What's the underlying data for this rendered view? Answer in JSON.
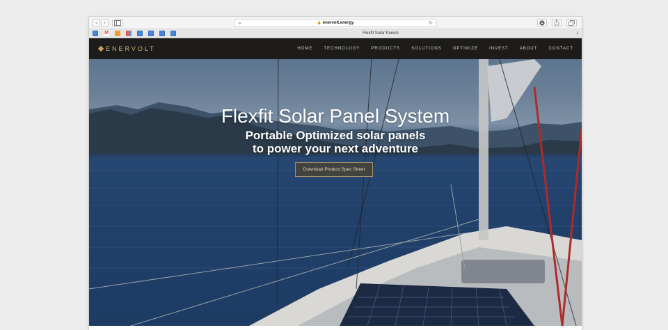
{
  "browser": {
    "url": "enervolt.energy",
    "tab_title": "Flexfit Solar Panels",
    "nav": {
      "back_icon": "‹",
      "forward_icon": "›"
    },
    "tab_plus": "+"
  },
  "site": {
    "logo": "ENERVOLT",
    "menu": [
      "HOME",
      "TECHNOLOGY",
      "PRODUCTS",
      "SOLUTIONS",
      "OPTIMIZE",
      "INVEST",
      "ABOUT",
      "CONTACT"
    ]
  },
  "hero": {
    "title": "Flexfit Solar Panel System",
    "subtitle_line1": "Portable Optimized solar panels",
    "subtitle_line2": "to power your next adventure",
    "cta": "Download Product Spec Sheet"
  },
  "colors": {
    "nav_bg": "#1d1c1a",
    "logo_gold": "#c9b27d",
    "cta_border": "#a6906a"
  }
}
